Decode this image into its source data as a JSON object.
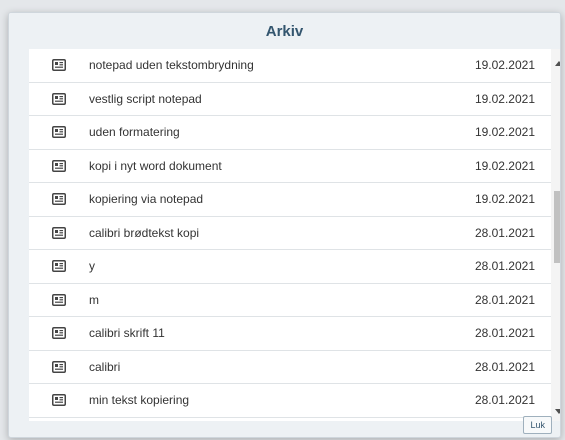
{
  "dialog": {
    "title": "Arkiv",
    "close_label": "Luk"
  },
  "colors": {
    "title": "#33556e",
    "row_border": "#dfe3e6",
    "scroll_thumb": "#c1c1c1"
  },
  "items": [
    {
      "icon": "document-icon",
      "name": "notepad uden tekstombrydning",
      "date": "19.02.2021"
    },
    {
      "icon": "document-icon",
      "name": "vestlig script notepad",
      "date": "19.02.2021"
    },
    {
      "icon": "document-icon",
      "name": "uden formatering",
      "date": "19.02.2021"
    },
    {
      "icon": "document-icon",
      "name": "kopi i nyt word dokument",
      "date": "19.02.2021"
    },
    {
      "icon": "document-icon",
      "name": "kopiering via notepad",
      "date": "19.02.2021"
    },
    {
      "icon": "document-icon",
      "name": "calibri brødtekst kopi",
      "date": "28.01.2021"
    },
    {
      "icon": "document-icon",
      "name": "y",
      "date": "28.01.2021"
    },
    {
      "icon": "document-icon",
      "name": "m",
      "date": "28.01.2021"
    },
    {
      "icon": "document-icon",
      "name": "calibri skrift 11",
      "date": "28.01.2021"
    },
    {
      "icon": "document-icon",
      "name": "calibri",
      "date": "28.01.2021"
    },
    {
      "icon": "document-icon",
      "name": "min tekst kopiering",
      "date": "28.01.2021"
    }
  ]
}
